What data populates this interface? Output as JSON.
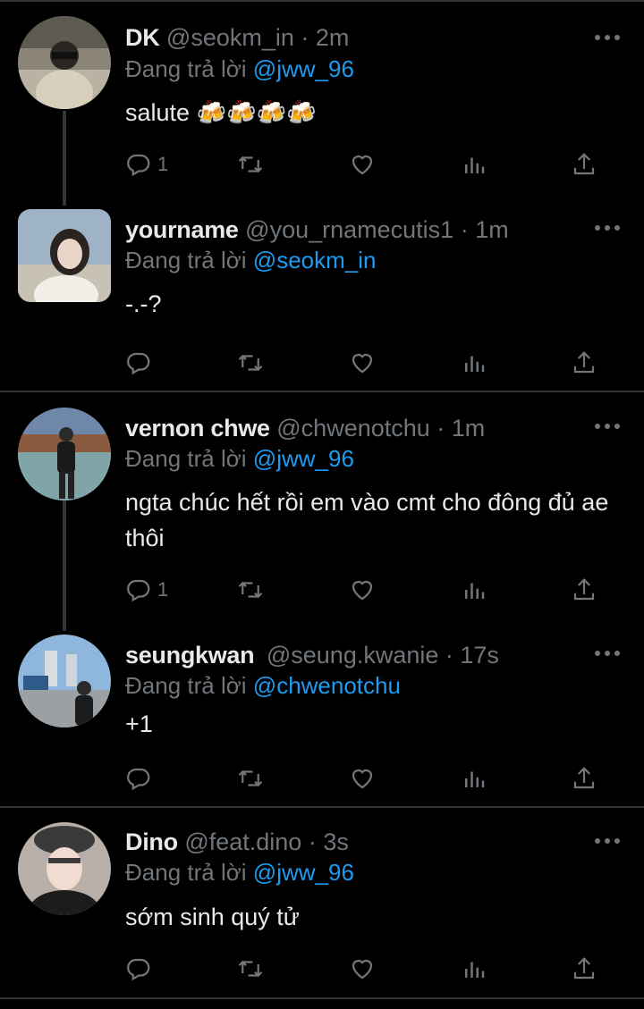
{
  "tweets": [
    {
      "name": "DK",
      "handle": "@seokm_in",
      "time": "· 2m",
      "reply_prefix": "Đang trả lời",
      "mention": "@jww_96",
      "text": "salute 🍻🍻🍻🍻",
      "reply_count": "1",
      "avatar_icon": "profile-photo"
    },
    {
      "name": "yourname",
      "handle": "@you_rnamecutis1",
      "time": "· 1m",
      "reply_prefix": "Đang trả lời",
      "mention": "@seokm_in",
      "text": "-.-?",
      "reply_count": "",
      "avatar_icon": "profile-photo"
    },
    {
      "name": "vernon chwe",
      "handle": "@chwenotchu",
      "time": "· 1m",
      "reply_prefix": "Đang trả lời",
      "mention": "@jww_96",
      "text": "ngta chúc hết rồi em vào cmt cho đông đủ ae thôi",
      "reply_count": "1",
      "avatar_icon": "profile-photo"
    },
    {
      "name": "seungkwan",
      "handle": "@seung.kwanie",
      "time": "· 17s",
      "reply_prefix": "Đang trả lời",
      "mention": "@chwenotchu",
      "text": "+1",
      "reply_count": "",
      "avatar_icon": "profile-photo"
    },
    {
      "name": "Dino",
      "handle": "@feat.dino",
      "time": "· 3s",
      "reply_prefix": "Đang trả lời",
      "mention": "@jww_96",
      "text": "sớm sinh quý tử",
      "reply_count": "",
      "avatar_icon": "profile-photo"
    }
  ],
  "icons": [
    "reply-icon",
    "retweet-icon",
    "like-icon",
    "views-icon",
    "share-icon",
    "more-icon"
  ],
  "colors": {
    "background": "#000000",
    "text": "#e7e9ea",
    "muted": "#71767b",
    "link": "#1d9bf0",
    "divider": "#2f3336"
  }
}
